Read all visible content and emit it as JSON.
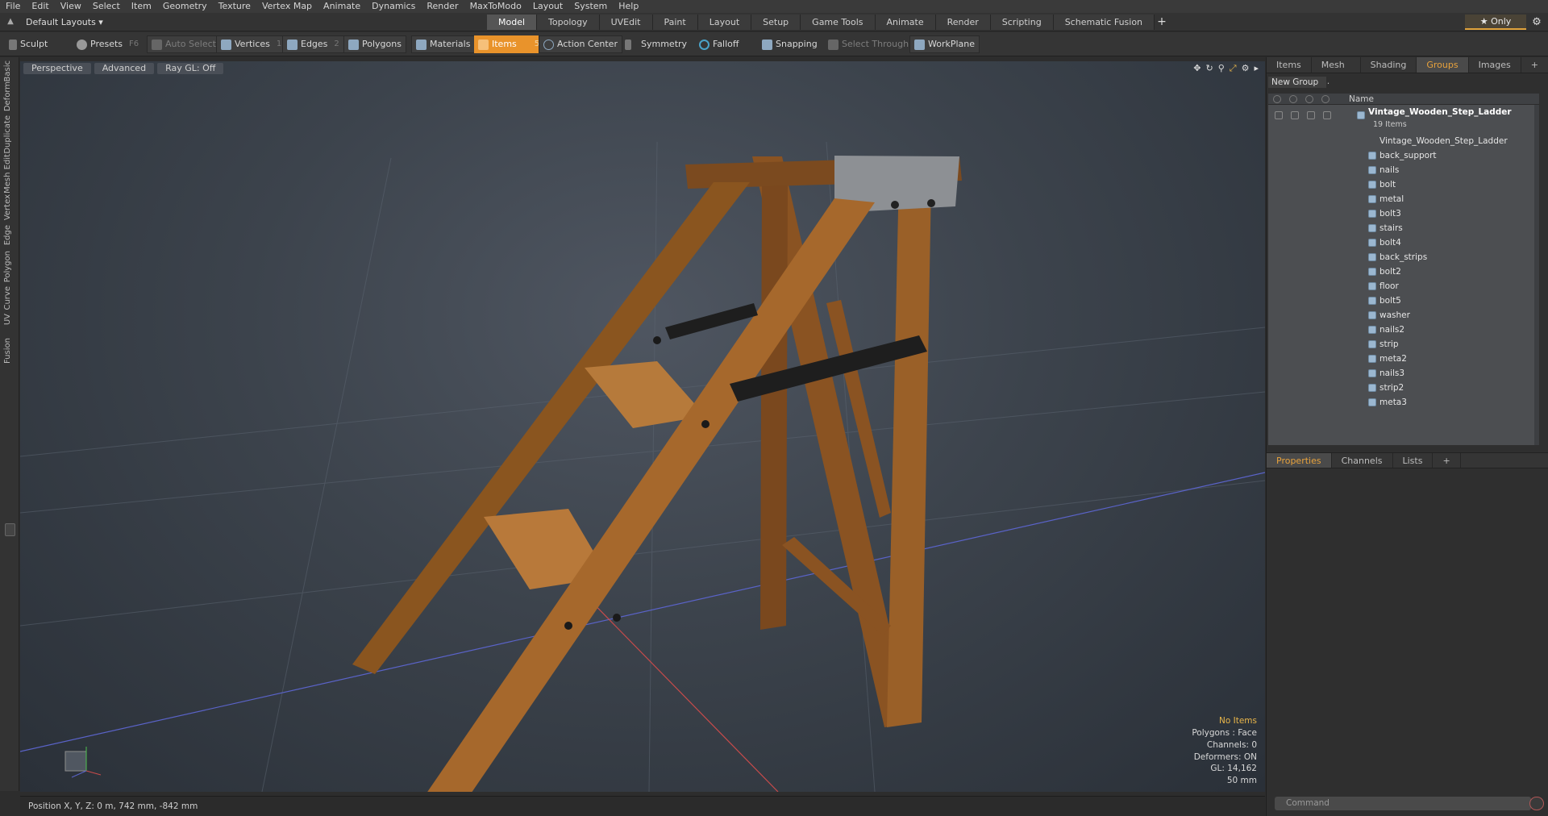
{
  "menu": [
    "File",
    "Edit",
    "View",
    "Select",
    "Item",
    "Geometry",
    "Texture",
    "Vertex Map",
    "Animate",
    "Dynamics",
    "Render",
    "MaxToModo",
    "Layout",
    "System",
    "Help"
  ],
  "layout_select": "Default Layouts ▾",
  "top_tabs": [
    "Model",
    "Topology",
    "UVEdit",
    "Paint",
    "Layout",
    "Setup",
    "Game Tools",
    "Animate",
    "Render",
    "Scripting",
    "Schematic Fusion"
  ],
  "active_top_tab": "Model",
  "only_label": "★  Only",
  "toolbar": {
    "sculpt": "Sculpt",
    "presets": "Presets",
    "presets_key": "F6",
    "auto_select": "Auto Select",
    "vertices": "Vertices",
    "vertices_key": "1",
    "edges": "Edges",
    "edges_key": "2",
    "polygons": "Polygons",
    "materials": "Materials",
    "items": "Items",
    "items_key": "5",
    "action_center": "Action Center",
    "symmetry": "Symmetry",
    "falloff": "Falloff",
    "snapping": "Snapping",
    "select_through": "Select Through",
    "workplane": "WorkPlane"
  },
  "left_tabs": [
    "Basic",
    "Deform",
    "Duplicate",
    "Mesh Edit",
    "Vertex",
    "Edge",
    "Polygon",
    "Curve",
    "UV",
    "Fusion"
  ],
  "viewport": {
    "perspective": "Perspective",
    "advanced": "Advanced",
    "raygl": "Ray GL: Off",
    "stats": {
      "no_items": "No Items",
      "polygons": "Polygons : Face",
      "channels": "Channels: 0",
      "deformers": "Deformers: ON",
      "gl": "GL: 14,162",
      "scale": "50 mm"
    }
  },
  "right_panel": {
    "tabs": [
      "Items",
      "Mesh ...",
      "Shading",
      "Groups",
      "Images"
    ],
    "active_tab": "Groups",
    "new_group": "New Group",
    "name_header": "Name",
    "root": {
      "label": "Vintage_Wooden_Step_Ladder",
      "sub": "19 Items"
    },
    "children": [
      "Vintage_Wooden_Step_Ladder",
      "back_support",
      "nails",
      "bolt",
      "metal",
      "bolt3",
      "stairs",
      "bolt4",
      "back_strips",
      "bolt2",
      "floor",
      "bolt5",
      "washer",
      "nails2",
      "strip",
      "meta2",
      "nails3",
      "strip2",
      "meta3"
    ],
    "props_tabs": [
      "Properties",
      "Channels",
      "Lists"
    ],
    "active_props_tab": "Properties",
    "command_placeholder": "Command"
  },
  "status": {
    "position": "Position X, Y, Z:  0 m, 742 mm, -842 mm"
  },
  "colors": {
    "accent": "#e9932b",
    "viewport_bg": "#3c434c",
    "wood": "#a8692c"
  }
}
